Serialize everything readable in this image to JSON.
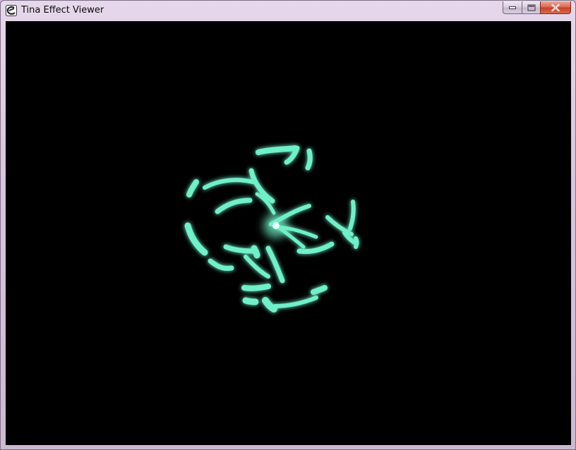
{
  "window": {
    "title": "Tina Effect Viewer",
    "app_icon": "tina-app-icon",
    "controls": {
      "minimize": "minimize-icon",
      "maximize": "maximize-icon",
      "close": "close-icon"
    }
  },
  "viewport": {
    "background_color": "#000000",
    "effect_color": "#6ff0c8",
    "effect_core_color": "#e8fff6"
  }
}
